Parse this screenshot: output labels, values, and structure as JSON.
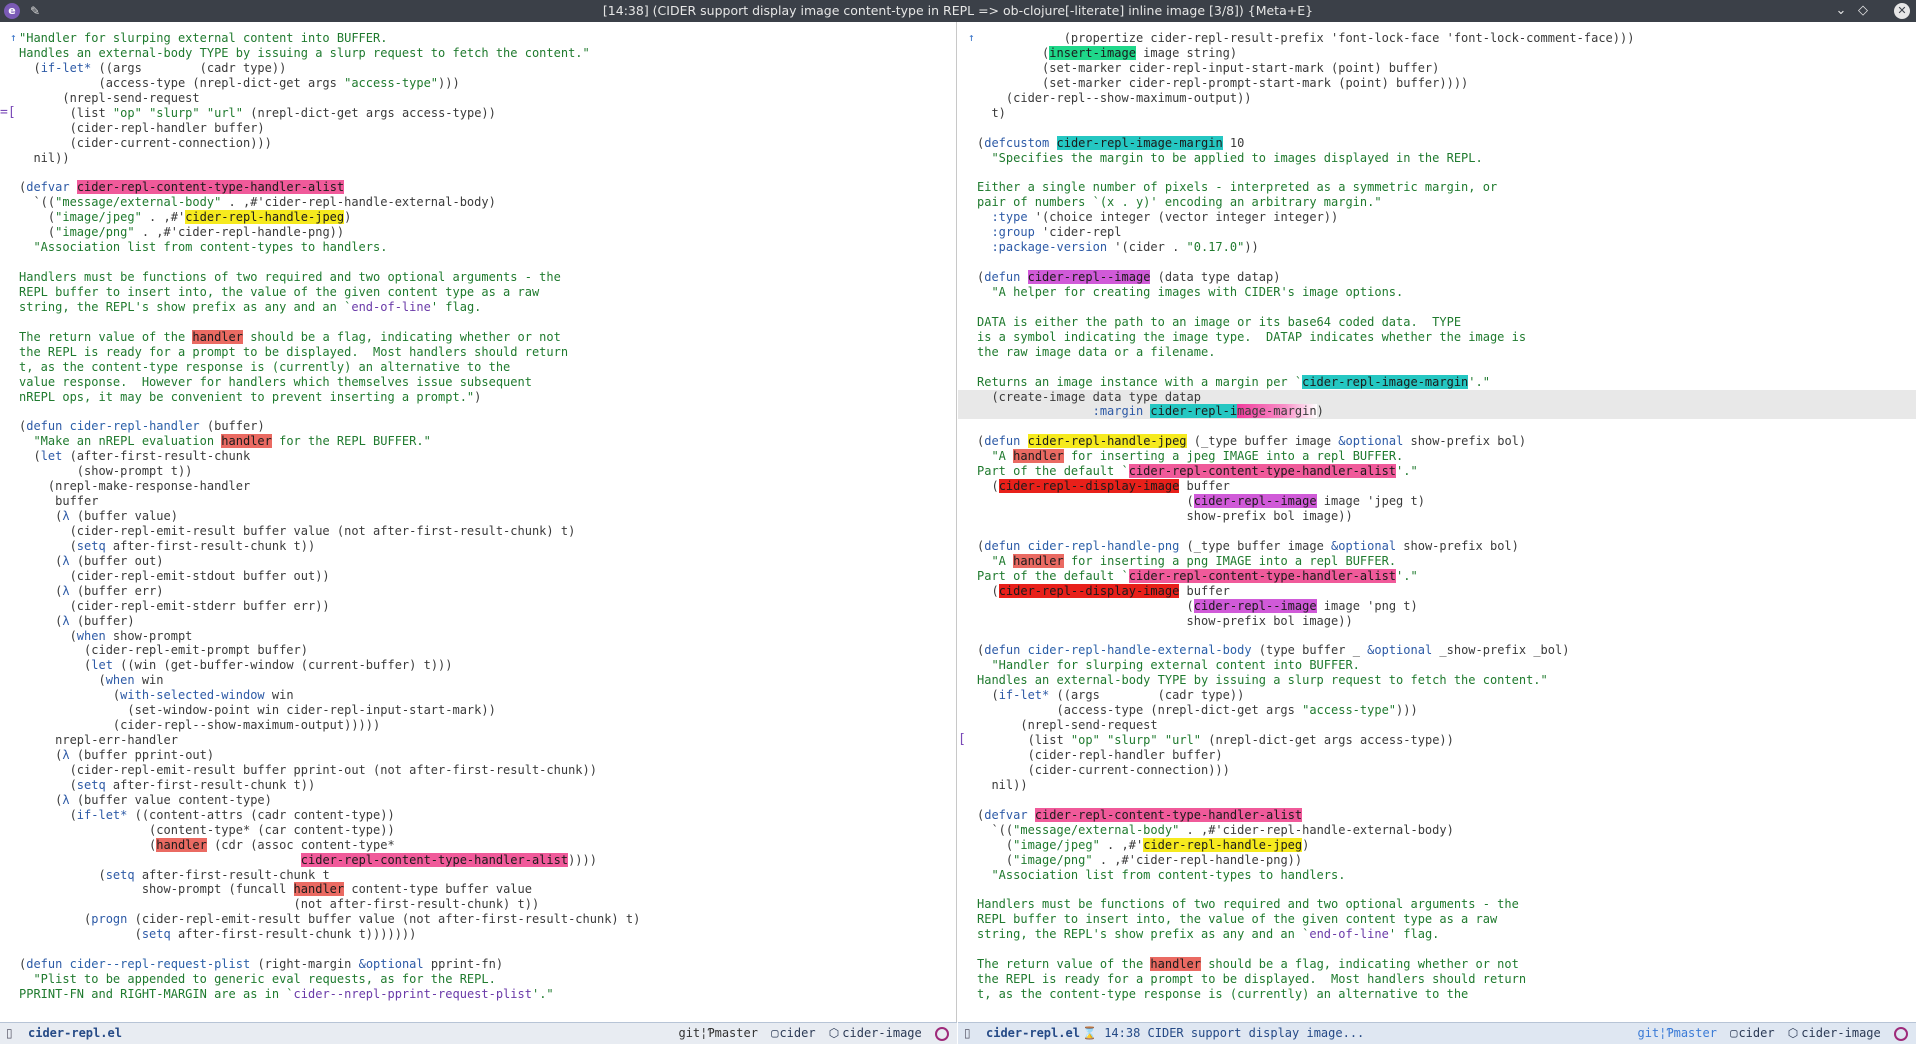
{
  "titlebar": {
    "app_icon": "emacs-icon",
    "pin_icon": "pin-icon",
    "title": "[14:38] (CIDER support display image content-type in REPL => ob-clojure[-literate] inline image [3/8]) {Meta+E}",
    "controls": [
      "chevron-down-icon",
      "diamond-icon",
      "close-icon"
    ]
  },
  "left_modeline": {
    "buffer": "cider-repl.el",
    "branch": "git¦Ƥmaster",
    "project": "cider",
    "project_icon": "folder-icon",
    "perspective": "cider-image",
    "perspective_icon": "workspace-icon"
  },
  "right_modeline": {
    "buffer": "cider-repl.el",
    "task": "14:38 CIDER support display image...",
    "branch": "git¦Ƥmaster",
    "project": "cider",
    "perspective": "cider-image"
  },
  "colors": {
    "pink": "#f05a9a",
    "yellow": "#f6ea1e",
    "red": "#ea6a62",
    "green": "#1fd88a",
    "cyan": "#25c7c2",
    "magenta": "#d05ad8",
    "string": "#1f7a2e",
    "keyword": "#2d5aa6"
  }
}
